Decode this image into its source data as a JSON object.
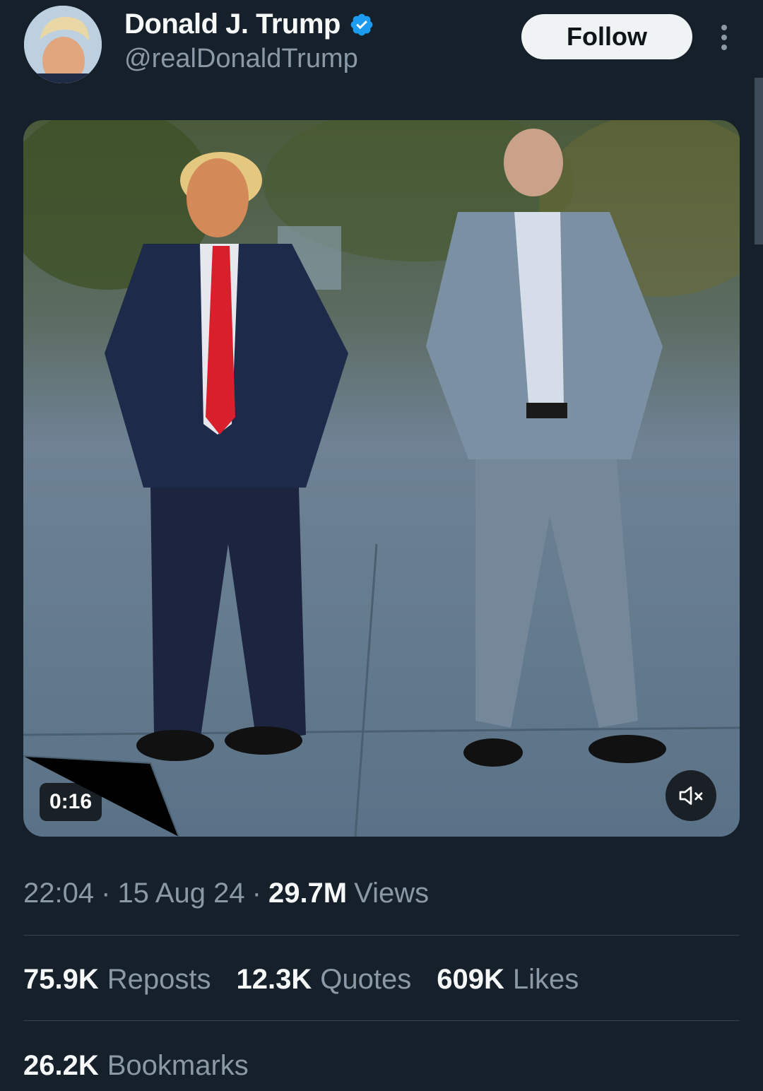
{
  "author": {
    "display_name": "Donald J. Trump",
    "handle": "@realDonaldTrump",
    "verified": true
  },
  "header": {
    "follow_label": "Follow"
  },
  "media": {
    "duration": "0:16",
    "muted": true
  },
  "meta": {
    "time": "22:04",
    "separator1": "·",
    "date": "15 Aug 24",
    "separator2": "·",
    "views_count": "29.7M",
    "views_label": "Views"
  },
  "stats": {
    "reposts_count": "75.9K",
    "reposts_label": "Reposts",
    "quotes_count": "12.3K",
    "quotes_label": "Quotes",
    "likes_count": "609K",
    "likes_label": "Likes",
    "bookmarks_count": "26.2K",
    "bookmarks_label": "Bookmarks"
  },
  "colors": {
    "background": "#15202b",
    "verified_blue": "#1d9bf0",
    "secondary_text": "#8b98a5",
    "primary_text": "#f7f9f9"
  }
}
